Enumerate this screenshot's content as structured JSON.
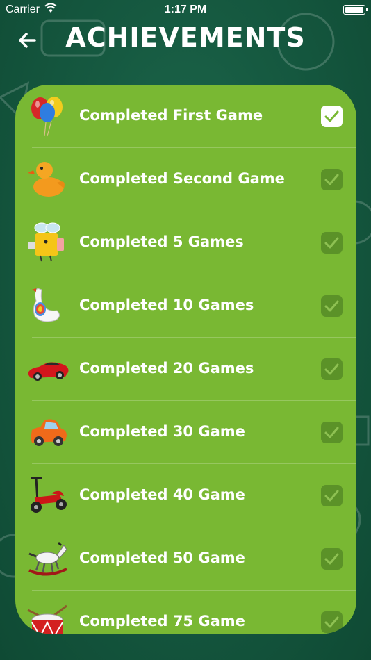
{
  "status_bar": {
    "carrier": "Carrier",
    "time": "1:17 PM"
  },
  "header": {
    "title": "ACHIEVEMENTS",
    "back_icon": "back-arrow-icon"
  },
  "colors": {
    "background": "#165a41",
    "card": "#79b833",
    "check_inactive": "#5b9228",
    "check_active": "#ffffff"
  },
  "achievements": [
    {
      "label": "Completed First Game",
      "icon": "balloons-icon",
      "checked": true
    },
    {
      "label": "Completed Second Game",
      "icon": "rubber-duck-icon",
      "checked": false
    },
    {
      "label": "Completed 5 Games",
      "icon": "bee-cube-icon",
      "checked": false
    },
    {
      "label": "Completed 10 Games",
      "icon": "goose-icon",
      "checked": false
    },
    {
      "label": "Completed 20 Games",
      "icon": "sports-car-icon",
      "checked": false
    },
    {
      "label": "Completed 30 Game",
      "icon": "toy-car-icon",
      "checked": false
    },
    {
      "label": "Completed 40 Game",
      "icon": "scooter-icon",
      "checked": false
    },
    {
      "label": "Completed 50 Game",
      "icon": "rocking-horse-icon",
      "checked": false
    },
    {
      "label": "Completed 75 Game",
      "icon": "drum-icon",
      "checked": false
    }
  ]
}
